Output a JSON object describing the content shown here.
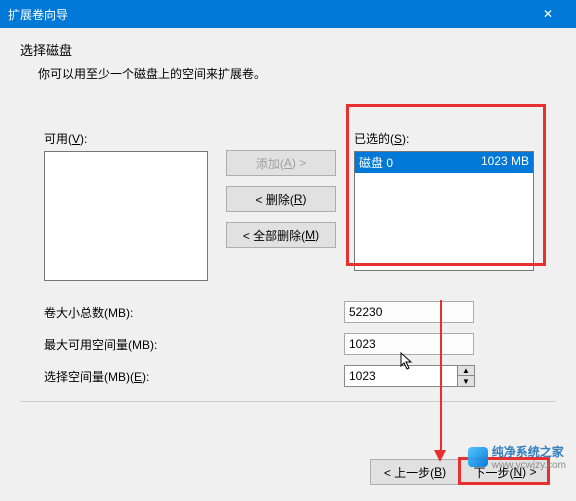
{
  "titlebar": {
    "title": "扩展卷向导",
    "close_glyph": "✕"
  },
  "header": {
    "heading": "选择磁盘",
    "subheading": "你可以用至少一个磁盘上的空间来扩展卷。"
  },
  "lists": {
    "available_label_pre": "可用(",
    "available_key": "V",
    "available_label_post": "):",
    "selected_label_pre": "已选的(",
    "selected_key": "S",
    "selected_label_post": "):",
    "selected_item_name": "磁盘 0",
    "selected_item_size": "1023 MB"
  },
  "buttons": {
    "add_pre": "添加(",
    "add_key": "A",
    "add_post": ") >",
    "remove_pre": "< 删除(",
    "remove_key": "R",
    "remove_post": ")",
    "remove_all_pre": "< 全部删除(",
    "remove_all_key": "M",
    "remove_all_post": ")"
  },
  "fields": {
    "total_label": "卷大小总数(MB):",
    "total_value": "52230",
    "max_label": "最大可用空间量(MB):",
    "max_value": "1023",
    "select_label_pre": "选择空间量(MB)(",
    "select_key": "E",
    "select_label_post": "):",
    "select_value": "1023"
  },
  "footer": {
    "back_pre": "< 上一步(",
    "back_key": "B",
    "back_post": ")",
    "next_pre": "下一步(",
    "next_key": "N",
    "next_post": ") >"
  },
  "watermark": {
    "text": "纯净系统之家",
    "url": "www.ycwjzy.com"
  }
}
